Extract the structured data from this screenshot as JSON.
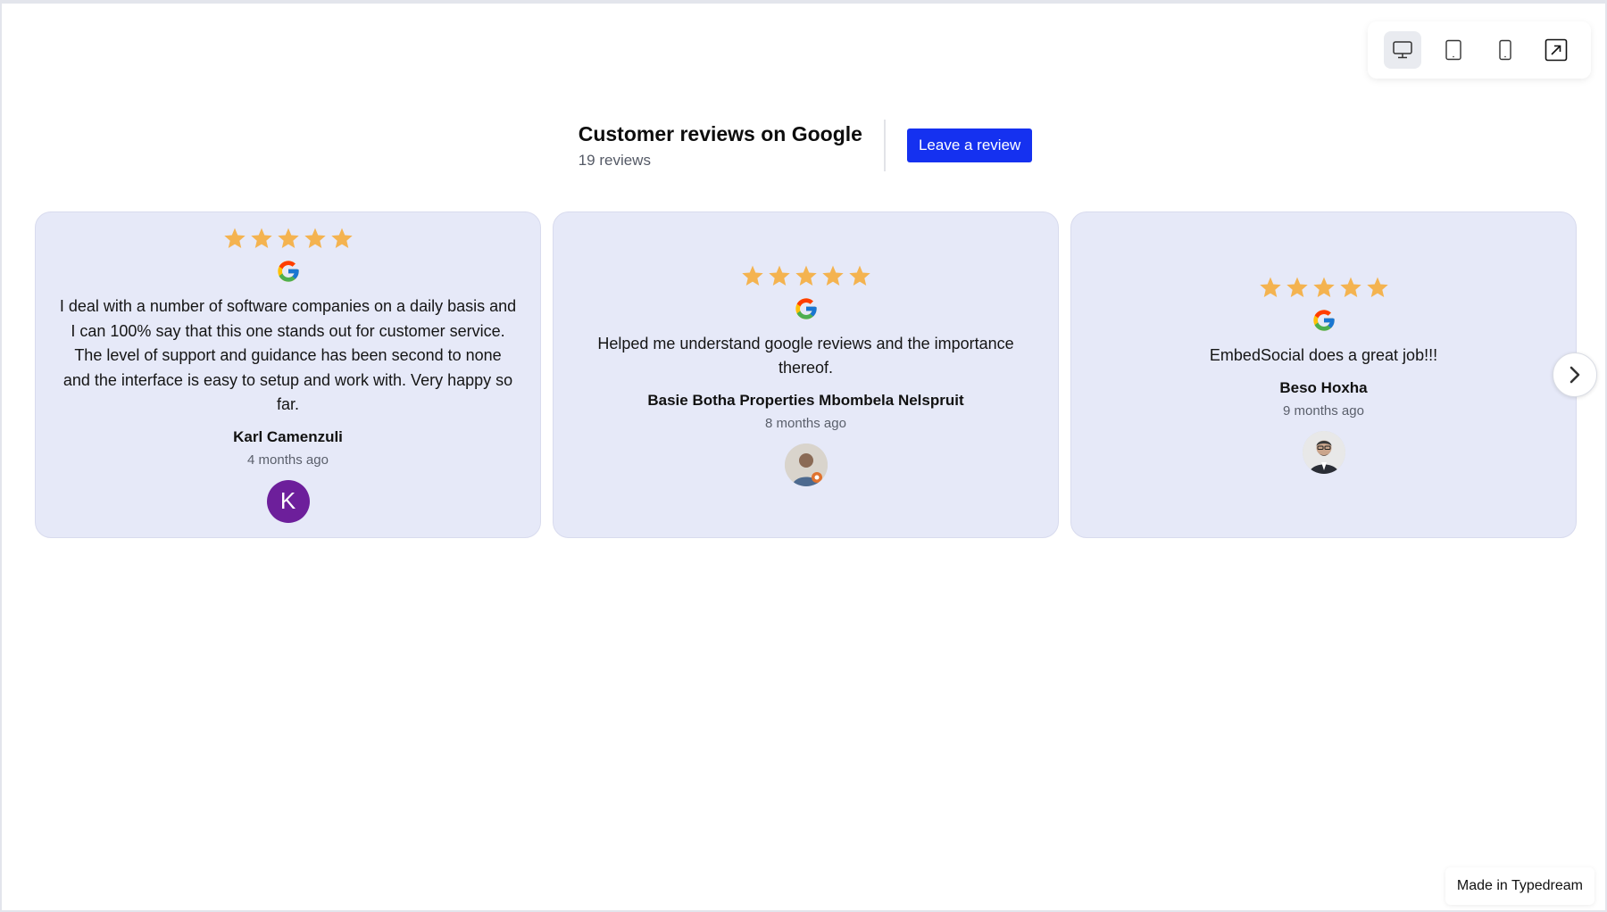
{
  "device_bar": {
    "items": [
      {
        "icon": "desktop-icon",
        "active": true
      },
      {
        "icon": "tablet-icon",
        "active": false
      },
      {
        "icon": "mobile-icon",
        "active": false
      },
      {
        "icon": "open-external-icon",
        "active": false
      }
    ]
  },
  "header": {
    "title": "Customer reviews on Google",
    "count": "19 reviews",
    "button_label": "Leave a review"
  },
  "reviews": [
    {
      "rating": 5,
      "source_icon": "google-icon",
      "text": "I deal with a number of software companies on a daily basis and I can 100% say that this one stands out for customer service. The level of support and guidance has been second to none and the interface is easy to setup and work with. Very happy so far.",
      "author": "Karl Camenzuli",
      "time": "4 months ago",
      "avatar_letter": "K",
      "avatar_color": "#6d1f9b"
    },
    {
      "rating": 5,
      "source_icon": "google-icon",
      "text": "Helped me understand google reviews and the importance thereof.",
      "author": "Basie Botha Properties Mbombela Nelspruit",
      "time": "8 months ago",
      "avatar_icon": "user-photo-icon"
    },
    {
      "rating": 5,
      "source_icon": "google-icon",
      "text": "EmbedSocial does a great job!!!",
      "author": "Beso Hoxha",
      "time": "9 months ago",
      "avatar_icon": "user-photo-icon"
    }
  ],
  "carousel": {
    "next_icon": "chevron-right-icon"
  },
  "footer": {
    "badge": "Made in Typedream"
  },
  "colors": {
    "accent": "#1531f0",
    "card_bg": "#e6e9f8",
    "star": "#f4b350"
  }
}
